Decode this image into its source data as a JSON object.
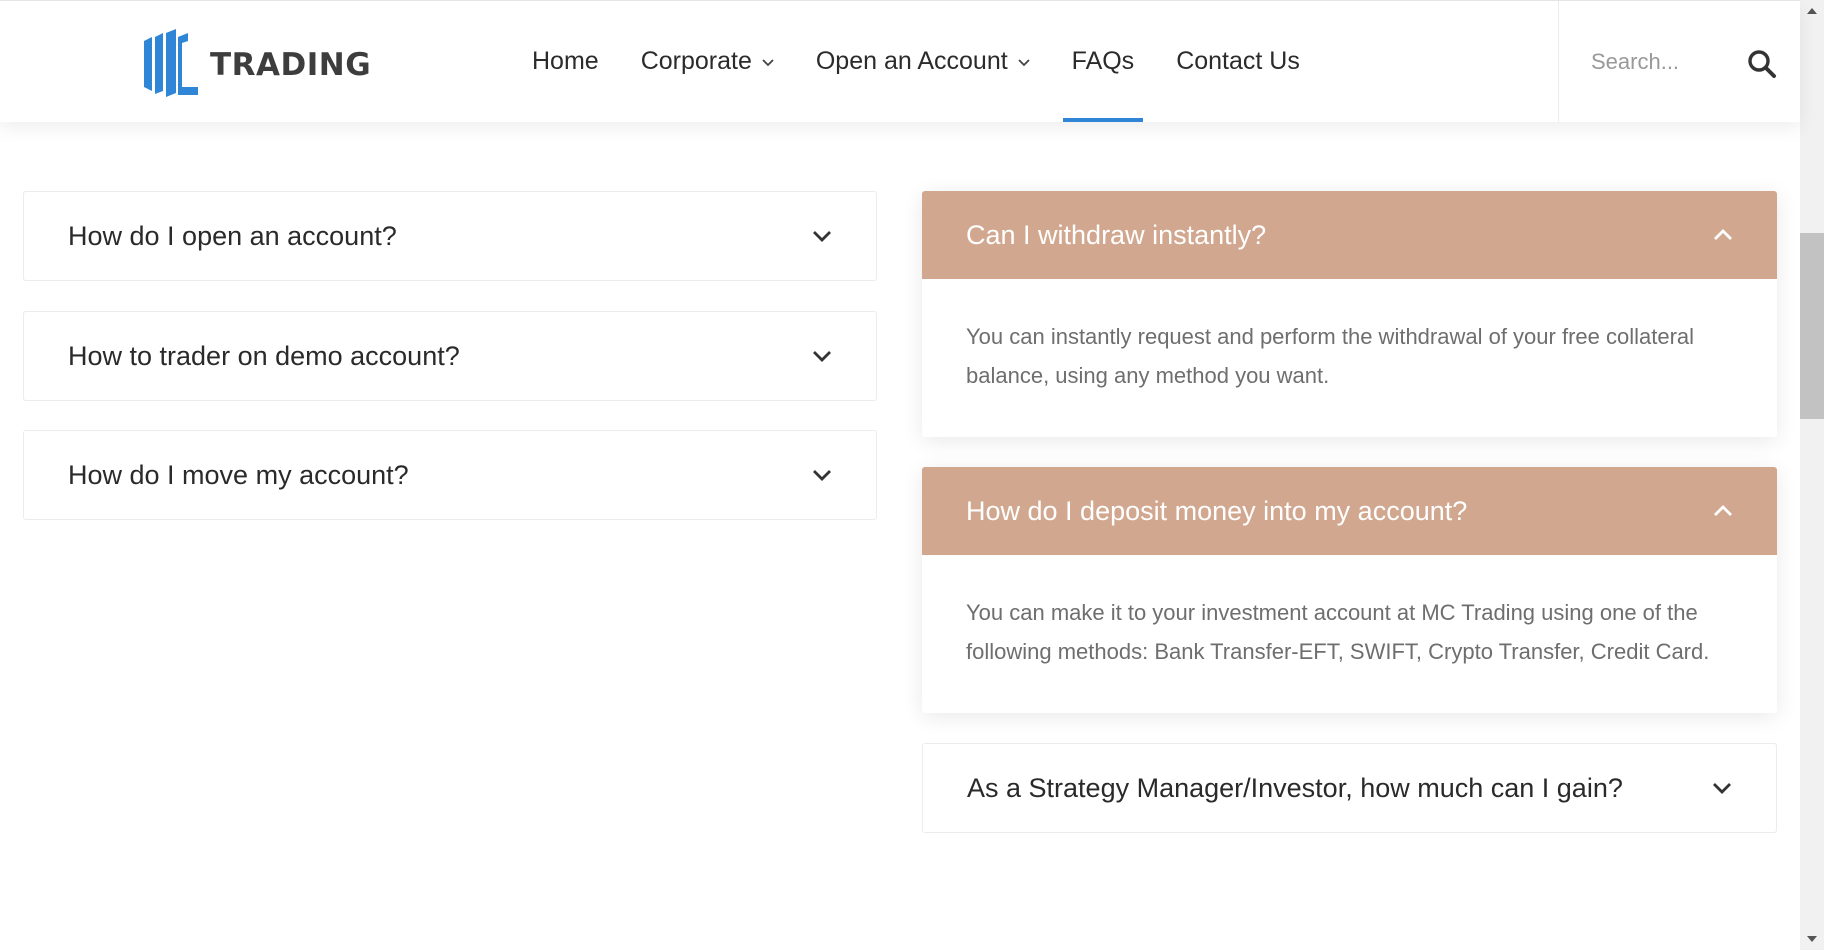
{
  "header": {
    "logo_text": "TRADING",
    "nav": [
      {
        "label": "Home"
      },
      {
        "label": "Corporate"
      },
      {
        "label": "Open an Account"
      },
      {
        "label": "FAQs"
      },
      {
        "label": "Contact Us"
      }
    ],
    "search_placeholder": "Search..."
  },
  "colors": {
    "accent": "#2f86d6",
    "faq_open_header": "#d1a88f",
    "logo_blue": "#2f86d6"
  },
  "faq_left": [
    {
      "question": "How do I open an account?"
    },
    {
      "question": "How to trader on demo account?"
    },
    {
      "question": "How do I move my account?"
    }
  ],
  "faq_right": [
    {
      "question": "Can I withdraw instantly?",
      "answer": "You can instantly request and perform the withdrawal of your free collateral balance, using any method you want."
    },
    {
      "question": "How do I deposit money into my account?",
      "answer": "You can make it to your investment account at MC Trading using one of the following methods: Bank Transfer-EFT, SWIFT, Crypto Transfer, Credit Card."
    },
    {
      "question": "As a Strategy Manager/Investor, how much can I gain?"
    }
  ],
  "icons": [
    "chevron-down-icon",
    "chevron-up-icon",
    "search-icon",
    "logo-mark-icon"
  ]
}
